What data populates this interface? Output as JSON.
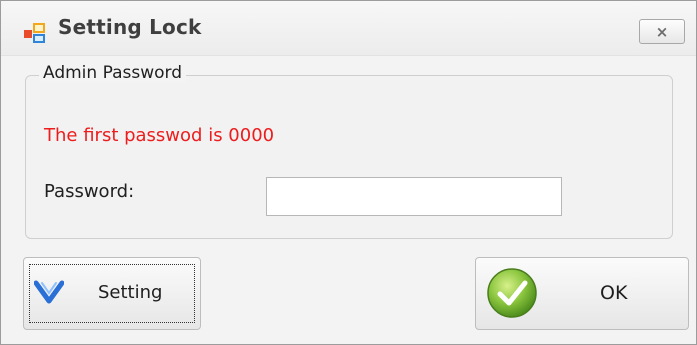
{
  "window": {
    "title": "Setting Lock",
    "close_label": "×",
    "icons": {
      "app": "settings-app-icon",
      "close": "close-icon"
    }
  },
  "group": {
    "legend": "Admin Password",
    "note": "The first passwod is 0000",
    "note_color": "#ee1c1c",
    "password_label": "Password:",
    "password_value": ""
  },
  "buttons": {
    "setting_label": "Setting",
    "setting_icon": "chevron-down-icon",
    "ok_label": "OK",
    "ok_icon": "checkmark-icon"
  }
}
